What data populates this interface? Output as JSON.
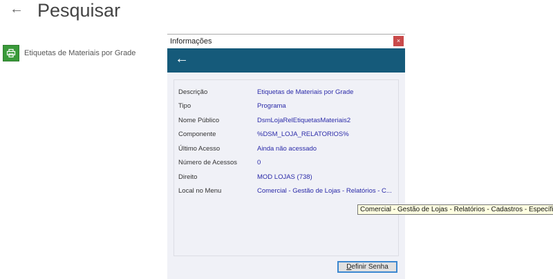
{
  "page": {
    "back_icon": "arrow-left-icon",
    "title": "Pesquisar"
  },
  "results": [
    {
      "icon": "printer-icon",
      "label": "Etiquetas de Materiais por Grade"
    }
  ],
  "dialog": {
    "title": "Informações",
    "close_label": "×",
    "rows": [
      {
        "label": "Descrição",
        "value": "Etiquetas de Materiais por Grade"
      },
      {
        "label": "Tipo",
        "value": "Programa"
      },
      {
        "label": "Nome Público",
        "value": "DsmLojaRelEtiquetasMateriais2"
      },
      {
        "label": "Componente",
        "value": "%DSM_LOJA_RELATORIOS%"
      },
      {
        "label": "Último Acesso",
        "value": "Ainda não acessado"
      },
      {
        "label": "Número de Acessos",
        "value": "0"
      },
      {
        "label": "Direito",
        "value": "MOD LOJAS (738)"
      },
      {
        "label": "Local no Menu",
        "value": "Comercial - Gestão de Lojas - Relatórios - C..."
      }
    ],
    "button_first": "D",
    "button_rest": "efinir Senha"
  },
  "tooltip": "Comercial - Gestão de Lojas - Relatórios - Cadastros - Específicos"
}
